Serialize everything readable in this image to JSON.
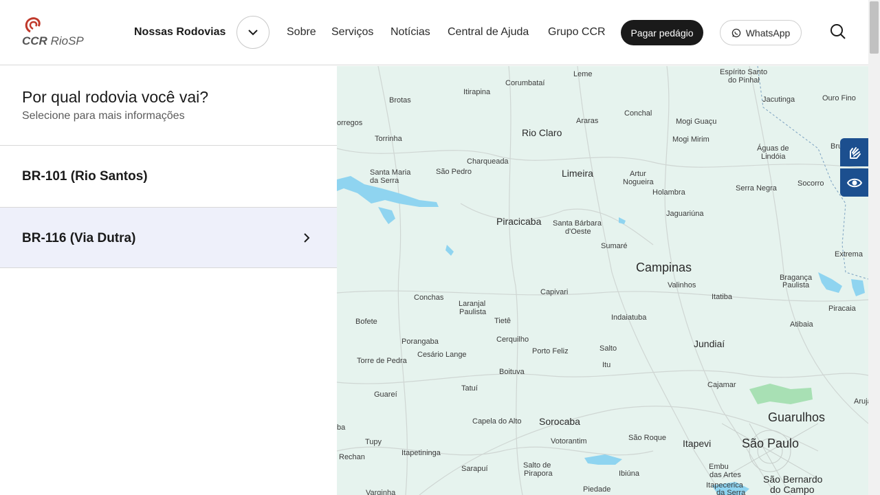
{
  "header": {
    "logo_text_bold": "CCR",
    "logo_text": "RioSP",
    "nossas_rodovias": "Nossas Rodovias",
    "nav": [
      "Sobre",
      "Serviços",
      "Notícias",
      "Central de Ajuda",
      "Grupo CCR"
    ],
    "pay_button": "Pagar pedágio",
    "whatsapp_button": "WhatsApp"
  },
  "panel": {
    "title": "Por qual rodovia você vai?",
    "subtitle": "Selecione para mais informações",
    "roads": [
      "BR-101 (Rio Santos)",
      "BR-116 (Via Dutra)"
    ]
  },
  "map": {
    "cities_small": [
      "Leme",
      "Espírito Santo",
      "do Pinhal",
      "Corumbataí",
      "Itirapina",
      "Brotas",
      "Jacutinga",
      "Ouro Fino",
      "Conchal",
      "Araras",
      "Mogi Guaçu",
      "Torrinha",
      "Mogi Mirim",
      "orregos",
      "Charqueada",
      "Águas de",
      "Lindóia",
      "Santa Maria",
      "da Serra",
      "São Pedro",
      "Artur",
      "Nogueira",
      "Serra Negra",
      "Socorro",
      "Holambra",
      "Santa Bárbara",
      "d'Oeste",
      "Jaguariúna",
      "Sumaré",
      "Valinhos",
      "Bragança",
      "Paulista",
      "Conchas",
      "Laranjal",
      "Paulista",
      "Capivari",
      "Itatiba",
      "Tietê",
      "Indaiatuba",
      "Bofete",
      "Atibaia",
      "Porangaba",
      "Cerquilho",
      "Salto",
      "Torre de Pedra",
      "Cesário Lange",
      "Porto Feliz",
      "Itu",
      "Boituva",
      "Cajamar",
      "Guareí",
      "Tatuí",
      "Arujá",
      "Capela do Alto",
      "Tupy",
      "Votorantim",
      "São Roque",
      "Itapetininga",
      "Embu",
      "das Artes",
      "Itapecerica",
      "da Serra",
      "Salto de",
      "Pirapora",
      "Sarapuí",
      "Ibiúna",
      "Piedade",
      "Varginha",
      "Rechan",
      "ba",
      "Bru",
      "Extrema",
      "Piracaia"
    ],
    "cities_medium": [
      "Rio Claro",
      "Limeira",
      "Piracicaba",
      "Jundiaí",
      "Sorocaba",
      "Itapevi",
      "São Bernardo",
      "do Campo"
    ],
    "cities_large": [
      "Campinas",
      "Guarulhos",
      "São Paulo"
    ]
  },
  "colors": {
    "accent": "#1c4f8f",
    "map_bg": "#e6f3ee",
    "water": "#8fd4f0",
    "active_row": "#eef0fa"
  },
  "icons": [
    "chevron-down-icon",
    "whatsapp-icon",
    "search-icon",
    "chevron-right-icon",
    "sign-language-icon",
    "eye-icon"
  ]
}
